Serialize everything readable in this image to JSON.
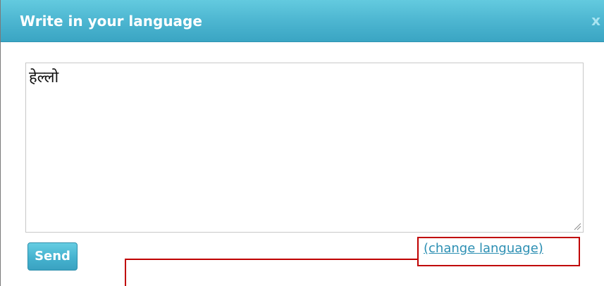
{
  "dialog": {
    "title": "Write in your language",
    "close_label": "x"
  },
  "textarea": {
    "value": "हेल्लो"
  },
  "actions": {
    "send_label": "Send",
    "change_language_label": "(change language)"
  },
  "colors": {
    "title_bar": "#4db6d1",
    "button": "#45b2cf",
    "link": "#2c8fb3",
    "annotation": "#c00000"
  }
}
